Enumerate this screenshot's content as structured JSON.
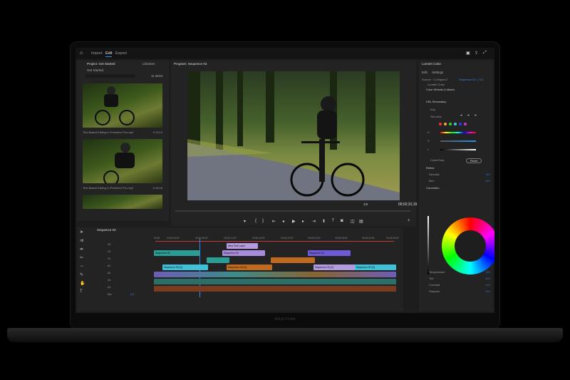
{
  "workspace_tabs": [
    "Import",
    "Edit",
    "Export"
  ],
  "active_workspace": "Edit",
  "project_panel": {
    "tabs": [
      "Project: Get Started",
      "Libraries"
    ],
    "item_count": "11 items",
    "bin_label": "Get Started",
    "clips": [
      {
        "name": "Text-Based Editing in Premiere Pro.mp4",
        "duration": "2:13:13"
      },
      {
        "name": "Text-Based Editing in Premiere Pro.mp4",
        "duration": "0:16:18"
      }
    ]
  },
  "program_monitor": {
    "title": "Program: Sequence 03",
    "fit": "1/2",
    "timecode": "00;02;31;15"
  },
  "timeline": {
    "title": "Sequence 03",
    "ruler": [
      "00;00",
      "00;00;04;00",
      "00;00;08;00",
      "00;00;12;00",
      "00;00;16;00",
      "00;00;20;00",
      "00;00;24;00",
      "00;00;28;00",
      "00;00;32;00",
      "00;00;36;00",
      "00;00;4"
    ],
    "tracks": [
      "V3",
      "V2",
      "V1",
      "A1",
      "A2",
      "A3",
      "A4",
      "Mix"
    ],
    "mix_value": "0.0",
    "clips": {
      "title_clip": "New Text Layer",
      "seq_a": "Sequence 03",
      "seq_b": "Sequence 03",
      "seq_c": "Sequence 03",
      "v1_a": "Sequence 03 [V]",
      "v1_b": "Sequence 03 [V]",
      "v1_c": "Sequence 03 [V]",
      "v1_d": "Sequence 03 [V]"
    }
  },
  "lumetri": {
    "title": "Lumetri Color",
    "tabs": [
      "Edit",
      "Settings"
    ],
    "source": "Source · C:/Import 2",
    "target": "Sequence 03 · [ V ]",
    "preset": "Lumetri Color",
    "section": "Color Wheels & Match",
    "hsl": "HSL Secondary",
    "key": "Key",
    "set_color": "Set color",
    "hsl_labels": [
      "H",
      "S",
      "L"
    ],
    "color_gray": "Color/Gray",
    "reset": "Reset",
    "refine": "Refine",
    "denoise": "Denoise",
    "denoise_val": "0.0",
    "blur": "Blur",
    "blur_val": "0.0",
    "correction": "Correction",
    "sliders": [
      {
        "label": "Temperature",
        "value": "0.0"
      },
      {
        "label": "Tint",
        "value": "0.0"
      },
      {
        "label": "Contrast",
        "value": "0.0"
      },
      {
        "label": "Sharpen",
        "value": "0.0"
      }
    ]
  },
  "laptop_brand": "ASUS ProArt"
}
